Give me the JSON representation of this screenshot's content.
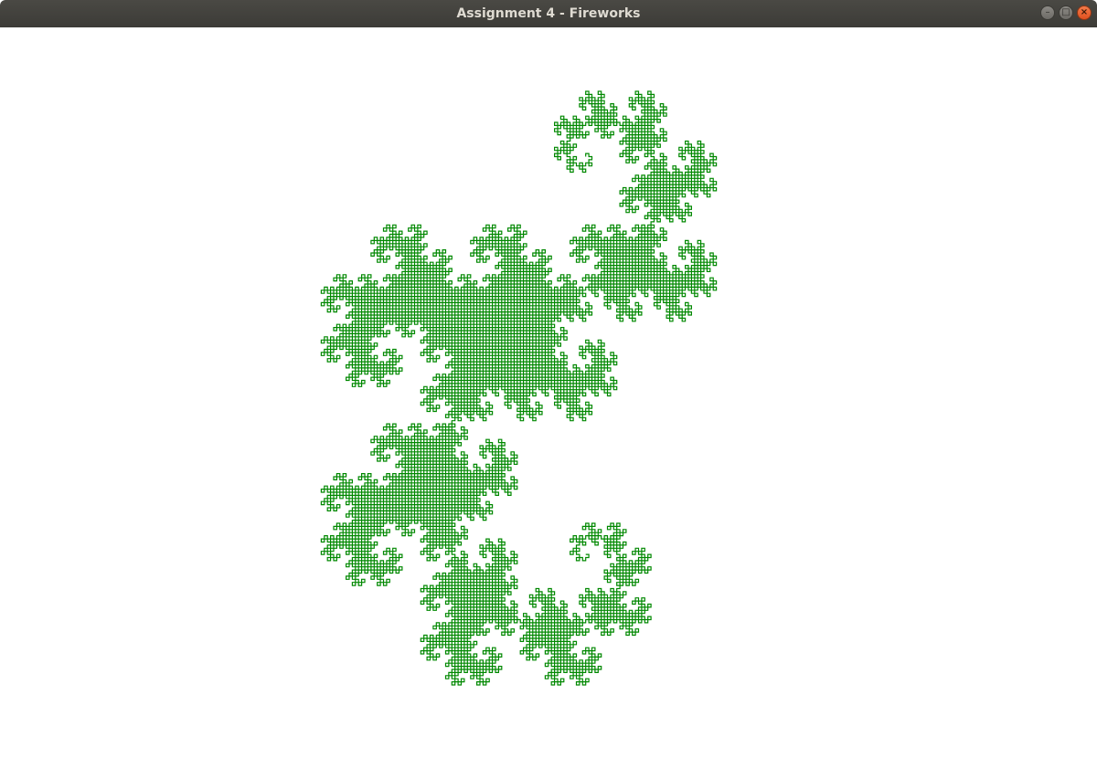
{
  "window": {
    "title": "Assignment 4 - Fireworks",
    "controls": {
      "minimize_icon": "minimize-icon",
      "maximize_icon": "maximize-icon",
      "close_icon": "close-icon"
    }
  },
  "canvas": {
    "background": "#ffffff",
    "stroke_color": "#008800",
    "figure": "dragon-curve",
    "iterations": 14
  }
}
